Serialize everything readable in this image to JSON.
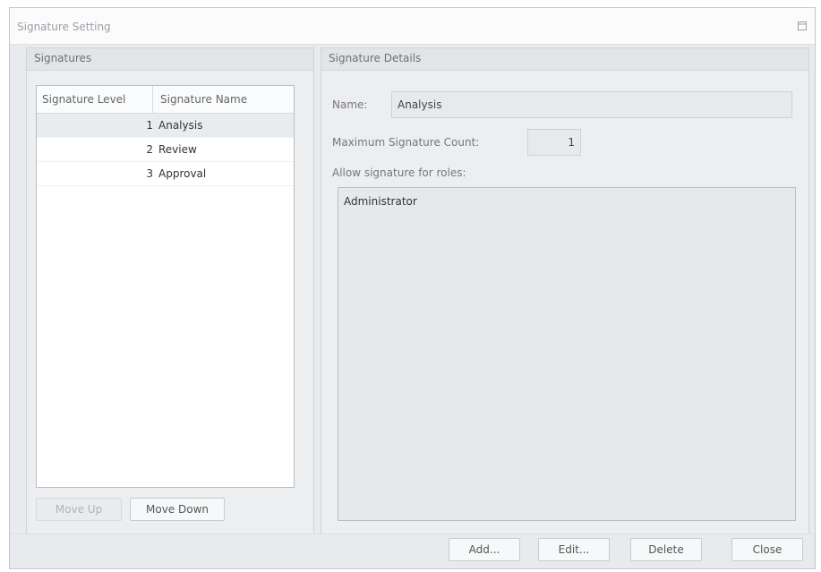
{
  "window": {
    "title": "Signature Setting"
  },
  "signatures": {
    "header": "Signatures",
    "columns": [
      "Signature Level",
      "Signature Name"
    ],
    "rows": [
      {
        "level": "1",
        "name": "Analysis",
        "selected": true
      },
      {
        "level": "2",
        "name": "Review",
        "selected": false
      },
      {
        "level": "3",
        "name": "Approval",
        "selected": false
      }
    ],
    "move_up": "Move Up",
    "move_down": "Move Down"
  },
  "details": {
    "header": "Signature Details",
    "name_label": "Name:",
    "name_value": "Analysis",
    "max_count_label": "Maximum Signature Count:",
    "max_count_value": "1",
    "roles_label": "Allow signature for roles:",
    "roles": [
      "Administrator"
    ]
  },
  "footer": {
    "add": "Add...",
    "edit": "Edit...",
    "delete": "Delete",
    "close": "Close"
  }
}
